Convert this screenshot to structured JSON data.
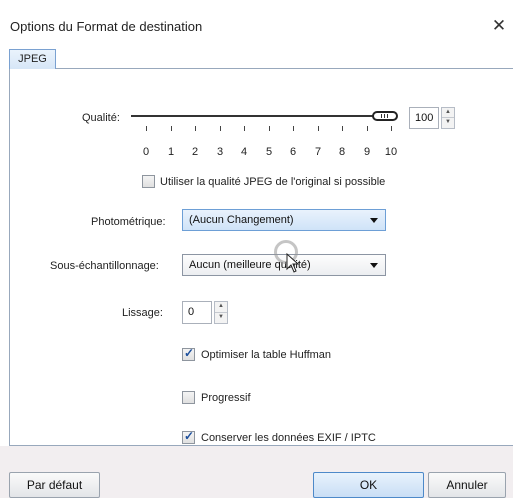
{
  "window": {
    "title": "Options du Format de destination",
    "close_glyph": "✕"
  },
  "tabs": [
    {
      "label": "JPEG",
      "selected": true
    }
  ],
  "quality": {
    "label": "Qualité:",
    "value": "100",
    "slider_min": 0,
    "slider_max": 10,
    "slider_value": 10,
    "tick_labels": [
      "0",
      "1",
      "2",
      "3",
      "4",
      "5",
      "6",
      "7",
      "8",
      "9",
      "10"
    ],
    "use_original_label": "Utiliser la qualité JPEG de l'original si possible",
    "use_original_checked": false
  },
  "photometric": {
    "label": "Photométrique:",
    "selected": "(Aucun Changement)"
  },
  "subsampling": {
    "label": "Sous-échantillonnage:",
    "selected": "Aucun (meilleure qualité)"
  },
  "smoothing": {
    "label": "Lissage:",
    "value": "0"
  },
  "options": {
    "optimize_huffman": {
      "label": "Optimiser la table Huffman",
      "checked": true
    },
    "progressive": {
      "label": "Progressif",
      "checked": false
    },
    "keep_exif": {
      "label": "Conserver les données EXIF / IPTC",
      "checked": true
    }
  },
  "footer": {
    "default_label": "Par défaut",
    "ok_label": "OK",
    "cancel_label": "Annuler"
  },
  "icons": {
    "spin_up": "▲",
    "spin_down": "▼",
    "check": "✓"
  },
  "colors": {
    "tab_border": "#7aa1d1",
    "ok_border": "#4d89c9",
    "check_mark": "#1d4f9c"
  }
}
